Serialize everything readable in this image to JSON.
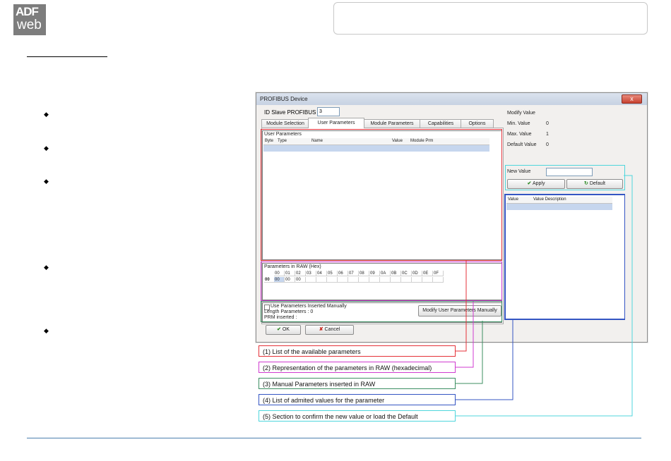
{
  "brand": {
    "logo_line1": "ADF",
    "logo_line2": "web"
  },
  "dialog": {
    "title": "PROFIBUS Device",
    "close_label": "x",
    "id_slave_label": "ID Slave PROFIBUS",
    "id_slave_value": "3",
    "tabs": [
      {
        "label": "Module Selection"
      },
      {
        "label": "User Parameters"
      },
      {
        "label": "Module Parameters"
      },
      {
        "label": "Capabilities"
      },
      {
        "label": "Options"
      }
    ],
    "user_params": {
      "title": "User Parameters",
      "columns": [
        "Byte",
        "Type",
        "Name",
        "Value",
        "Module Prm"
      ]
    },
    "raw": {
      "title": "Parameters in RAW (Hex)",
      "col_headers": [
        "00",
        "01",
        "02",
        "03",
        "04",
        "05",
        "06",
        "07",
        "08",
        "09",
        "0A",
        "0B",
        "0C",
        "0D",
        "0E",
        "0F"
      ],
      "row_header": "00",
      "values": [
        "00",
        "00",
        "00"
      ]
    },
    "manual": {
      "checkbox_label": "Use Parameters Inserted Manually",
      "length_label": "Length Parameters : 0",
      "prm_label": "PRM inserted :",
      "modify_button": "Modify User Parameters Manually"
    },
    "modify_value": {
      "title": "Modify Value",
      "min_label": "Min. Value",
      "min_value": "0",
      "max_label": "Max. Value",
      "max_value": "1",
      "default_label": "Default Value",
      "default_value": "0",
      "new_value_label": "New Value",
      "apply_label": "Apply",
      "default_button": "Default"
    },
    "value_table": {
      "columns": [
        "Value",
        "Value Description"
      ]
    },
    "ok_label": "OK",
    "cancel_label": "Cancel"
  },
  "annotations": [
    {
      "text": "(1) List of the available parameters",
      "color": "#e53138"
    },
    {
      "text": "(2) Representation of the parameters in RAW (hexadecimal)",
      "color": "#d03bd0"
    },
    {
      "text": "(3) Manual Parameters inserted in RAW",
      "color": "#3c8f62"
    },
    {
      "text": "(4) List of admited values for the parameter",
      "color": "#3455c3"
    },
    {
      "text": "(5) Section to confirm the new value or load the Default",
      "color": "#4fd6dc"
    }
  ]
}
